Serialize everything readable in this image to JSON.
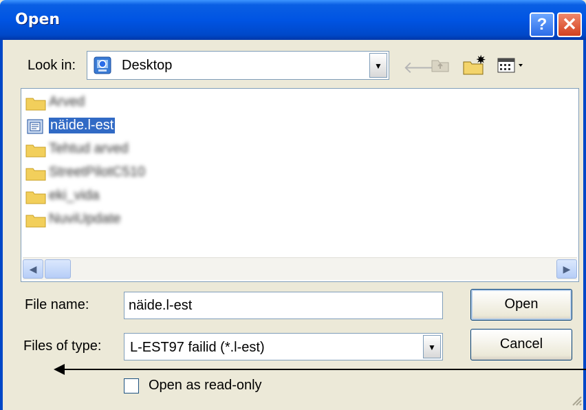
{
  "window": {
    "title": "Open",
    "help_label": "?",
    "close_label": "✕"
  },
  "lookin": {
    "label": "Look in:",
    "value": "Desktop"
  },
  "files": [
    {
      "name": "Arved",
      "type": "folder",
      "blurred": true
    },
    {
      "name": "näide.l-est",
      "type": "file",
      "selected": true
    },
    {
      "name": "Tehtud arved",
      "type": "folder",
      "blurred": true
    },
    {
      "name": "StreetPilotC510",
      "type": "folder",
      "blurred": true
    },
    {
      "name": "eki_vida",
      "type": "folder",
      "blurred": true
    },
    {
      "name": "NuviUpdate",
      "type": "folder",
      "blurred": true
    }
  ],
  "form": {
    "file_name_label": "File name:",
    "file_name_value": "näide.l-est",
    "file_type_label": "Files of type:",
    "file_type_value": "L-EST97 failid (*.l-est)",
    "readonly_label": "Open as read-only"
  },
  "buttons": {
    "open": "Open",
    "cancel": "Cancel"
  },
  "colors": {
    "titlebar": "#0054e3",
    "selection": "#316ac5",
    "dialog_bg": "#ece9d8"
  }
}
